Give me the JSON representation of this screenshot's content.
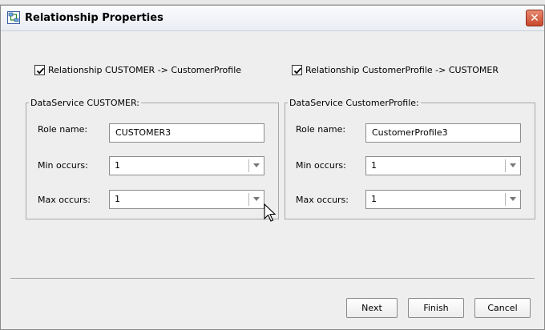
{
  "window": {
    "title": "Relationship Properties",
    "close_glyph": "✕"
  },
  "checkboxes": [
    {
      "label": "Relationship CUSTOMER -> CustomerProfile",
      "checked": true
    },
    {
      "label": "Relationship CustomerProfile -> CUSTOMER",
      "checked": true
    }
  ],
  "left_group": {
    "legend": "DataService CUSTOMER:",
    "role_label": "Role name:",
    "role_value": "CUSTOMER3",
    "min_label": "Min occurs:",
    "min_value": "1",
    "max_label": "Max occurs:",
    "max_value": "1"
  },
  "right_group": {
    "legend": "DataService CustomerProfile:",
    "role_label": "Role name:",
    "role_value": "CustomerProfile3",
    "min_label": "Min occurs:",
    "min_value": "1",
    "max_label": "Max occurs:",
    "max_value": "1"
  },
  "buttons": {
    "next": "Next",
    "finish": "Finish",
    "cancel": "Cancel"
  },
  "icons": {
    "title_icon": "relationship-icon",
    "cursor": "mouse-pointer-icon"
  },
  "colors": {
    "close_button": "#c9472b",
    "dialog_bg": "#eeeeee"
  }
}
